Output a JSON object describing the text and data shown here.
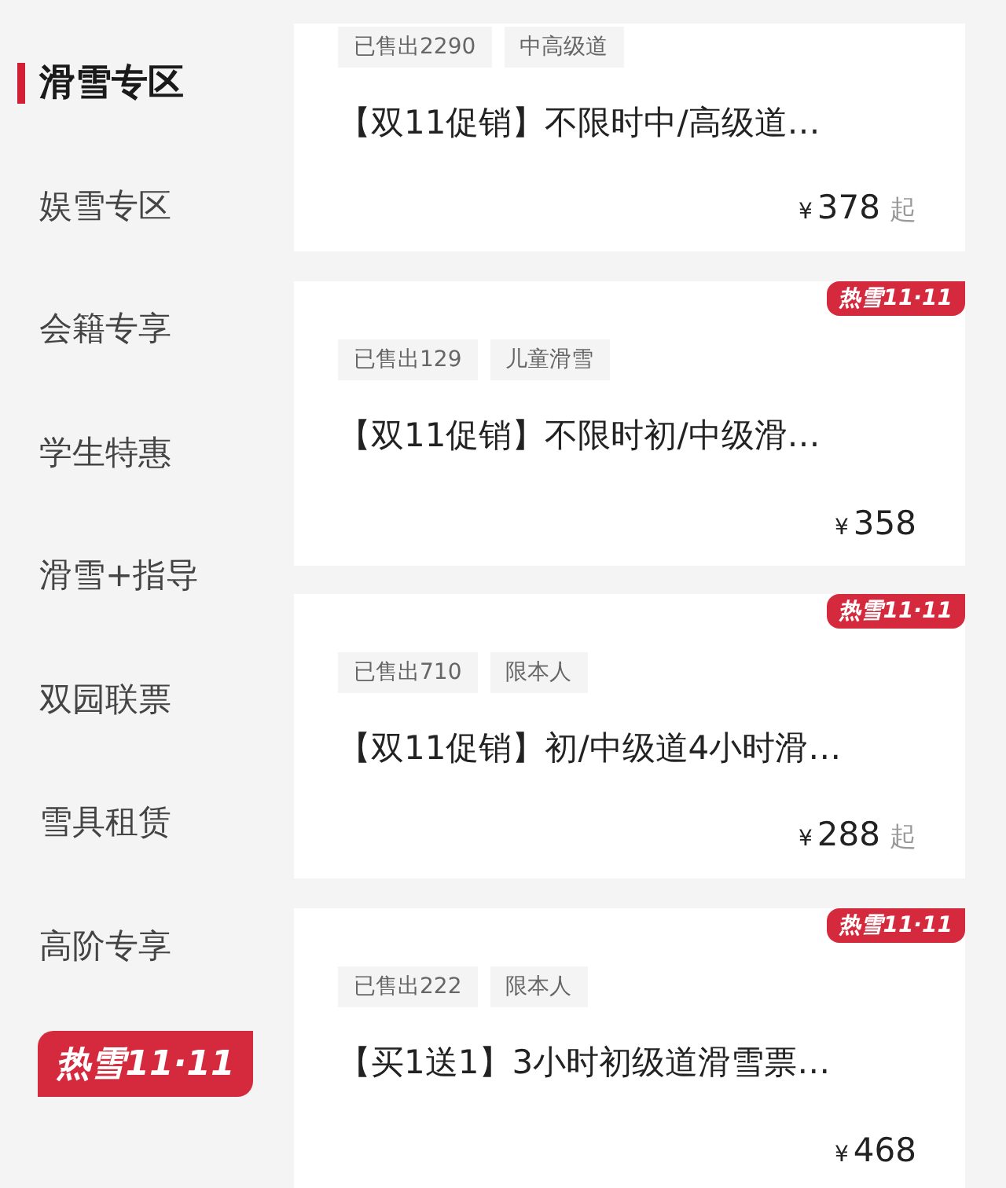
{
  "sidebar": {
    "items": [
      {
        "label": "滑雪专区",
        "selected": true
      },
      {
        "label": "娱雪专区",
        "selected": false
      },
      {
        "label": "会籍专享",
        "selected": false
      },
      {
        "label": "学生特惠",
        "selected": false
      },
      {
        "label": "滑雪+指导",
        "selected": false
      },
      {
        "label": "双园联票",
        "selected": false
      },
      {
        "label": "雪具租赁",
        "selected": false
      },
      {
        "label": "高阶专享",
        "selected": false
      }
    ],
    "promo_badge": "热雪11·11"
  },
  "products": [
    {
      "tags": [
        "已售出2290",
        "中高级道"
      ],
      "title": "【双11促销】不限时中/高级道…",
      "currency": "¥",
      "price": "378",
      "price_suffix": "起"
    },
    {
      "badge": "热雪11·11",
      "tags": [
        "已售出129",
        "儿童滑雪"
      ],
      "title": "【双11促销】不限时初/中级滑…",
      "currency": "¥",
      "price": "358"
    },
    {
      "badge": "热雪11·11",
      "tags": [
        "已售出710",
        "限本人"
      ],
      "title": "【双11促销】初/中级道4小时滑…",
      "currency": "¥",
      "price": "288",
      "price_suffix": "起"
    },
    {
      "badge": "热雪11·11",
      "tags": [
        "已售出222",
        "限本人"
      ],
      "title": "【买1送1】3小时初级道滑雪票…",
      "currency": "¥",
      "price": "468"
    }
  ]
}
